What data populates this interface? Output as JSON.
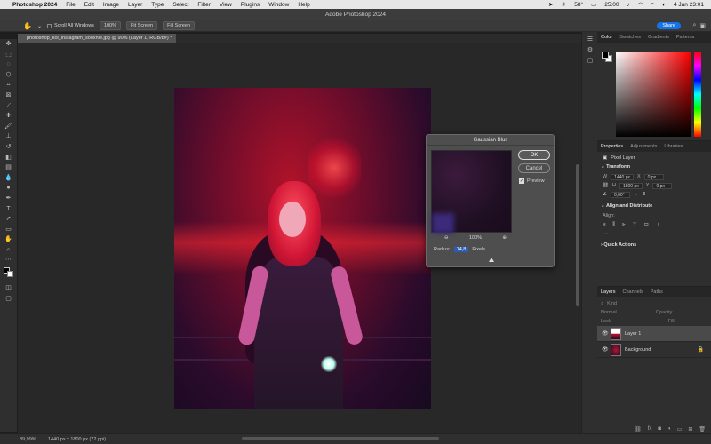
{
  "menubar": {
    "apple_icon": "apple-icon",
    "app_name": "Photoshop 2024",
    "items": [
      "File",
      "Edit",
      "Image",
      "Layer",
      "Type",
      "Select",
      "Filter",
      "View",
      "Plugins",
      "Window",
      "Help"
    ],
    "temperature": "58°",
    "time_status": "25:00",
    "date_time": "4 Jan 23:01"
  },
  "window": {
    "title": "Adobe Photoshop 2024"
  },
  "options_bar": {
    "scroll_all_label": "Scroll All Windows",
    "zoom_value": "100%",
    "fit_screen_label": "Fit Screen",
    "fill_screen_label": "Fill Screen",
    "share_label": "Share"
  },
  "document": {
    "tab_label": "photoshop_kol_instagram_sooxnie.jpg @ 90% (Layer 1, RGB/8#) *"
  },
  "toolbar": {
    "tools": [
      "move-icon",
      "marquee-icon",
      "lasso-icon",
      "object-select-icon",
      "crop-icon",
      "frame-icon",
      "eyedropper-icon",
      "healing-icon",
      "brush-icon",
      "stamp-icon",
      "history-brush-icon",
      "eraser-icon",
      "gradient-icon",
      "blur-icon",
      "dodge-icon",
      "pen-icon",
      "type-icon",
      "path-select-icon",
      "shape-icon",
      "hand-icon",
      "zoom-icon",
      "more-icon"
    ]
  },
  "gaussian_blur": {
    "title": "Gaussian Blur",
    "ok_label": "OK",
    "cancel_label": "Cancel",
    "preview_label": "Preview",
    "preview_checked": true,
    "zoom_level": "100%",
    "radius_label": "Radius:",
    "radius_value": "14,8",
    "radius_unit": "Pixels"
  },
  "color_panel": {
    "tabs": [
      "Color",
      "Swatches",
      "Gradients",
      "Patterns"
    ],
    "foreground": "#000000",
    "background": "#ffffff",
    "hue_color": "#ff0000"
  },
  "properties_panel": {
    "tabs": [
      "Properties",
      "Adjustments",
      "Libraries"
    ],
    "layer_type": "Pixel Layer",
    "transform_title": "Transform",
    "w_label": "W",
    "w_value": "1440 px",
    "h_label": "H",
    "h_value": "1800 px",
    "x_label": "X",
    "x_value": "0 px",
    "y_label": "Y",
    "y_value": "0 px",
    "angle_value": "0,00°",
    "align_title": "Align and Distribute",
    "align_label": "Align:",
    "quick_actions_title": "Quick Actions"
  },
  "layers_panel": {
    "tabs": [
      "Layers",
      "Channels",
      "Paths"
    ],
    "filter_placeholder": "Kind",
    "blend_mode": "Normal",
    "opacity_label": "Opacity",
    "lock_label": "Lock",
    "fill_label": "Fill",
    "layers": [
      {
        "name": "Layer 1",
        "selected": true
      },
      {
        "name": "Background",
        "selected": false
      }
    ]
  },
  "statusbar": {
    "zoom": "89,99%",
    "doc_info": "1440 px x 1800 px (72 ppi)"
  }
}
